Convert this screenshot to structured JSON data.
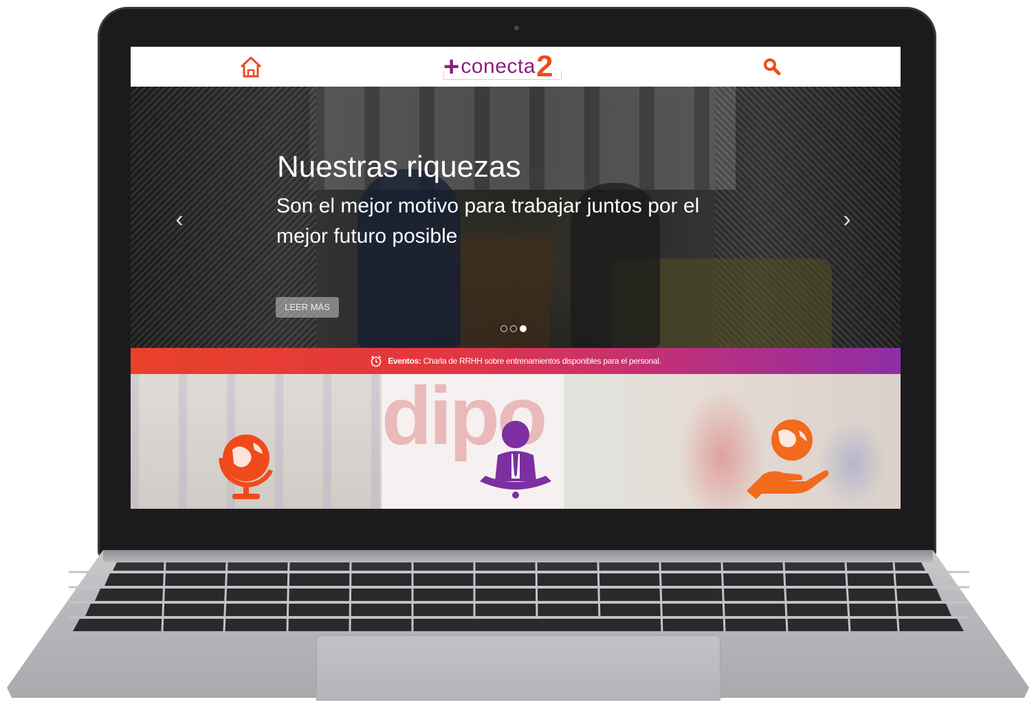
{
  "header": {
    "logo_plus": "+",
    "logo_text": "conecta",
    "logo_number": "2"
  },
  "hero": {
    "title": "Nuestras riquezas",
    "subtitle": "Son el mejor motivo para trabajar juntos por el mejor futuro posible",
    "button_label": "LEER MÁS",
    "prev_arrow": "‹",
    "next_arrow": "›",
    "slides_total": 3,
    "active_slide": 3
  },
  "event_bar": {
    "label": "Eventos:",
    "text": "Charla de RRHH sobre entrenamientos disponibles para el personal."
  },
  "tiles": [
    {
      "icon": "globe-icon"
    },
    {
      "icon": "person-meditation-icon",
      "background_text": "dipo"
    },
    {
      "icon": "hand-globe-icon"
    }
  ],
  "colors": {
    "brand_orange": "#f04a1c",
    "brand_purple": "#8a1f7f",
    "tile_icon_purple": "#7b2fa0",
    "tile_icon_orange": "#f26a1b"
  }
}
